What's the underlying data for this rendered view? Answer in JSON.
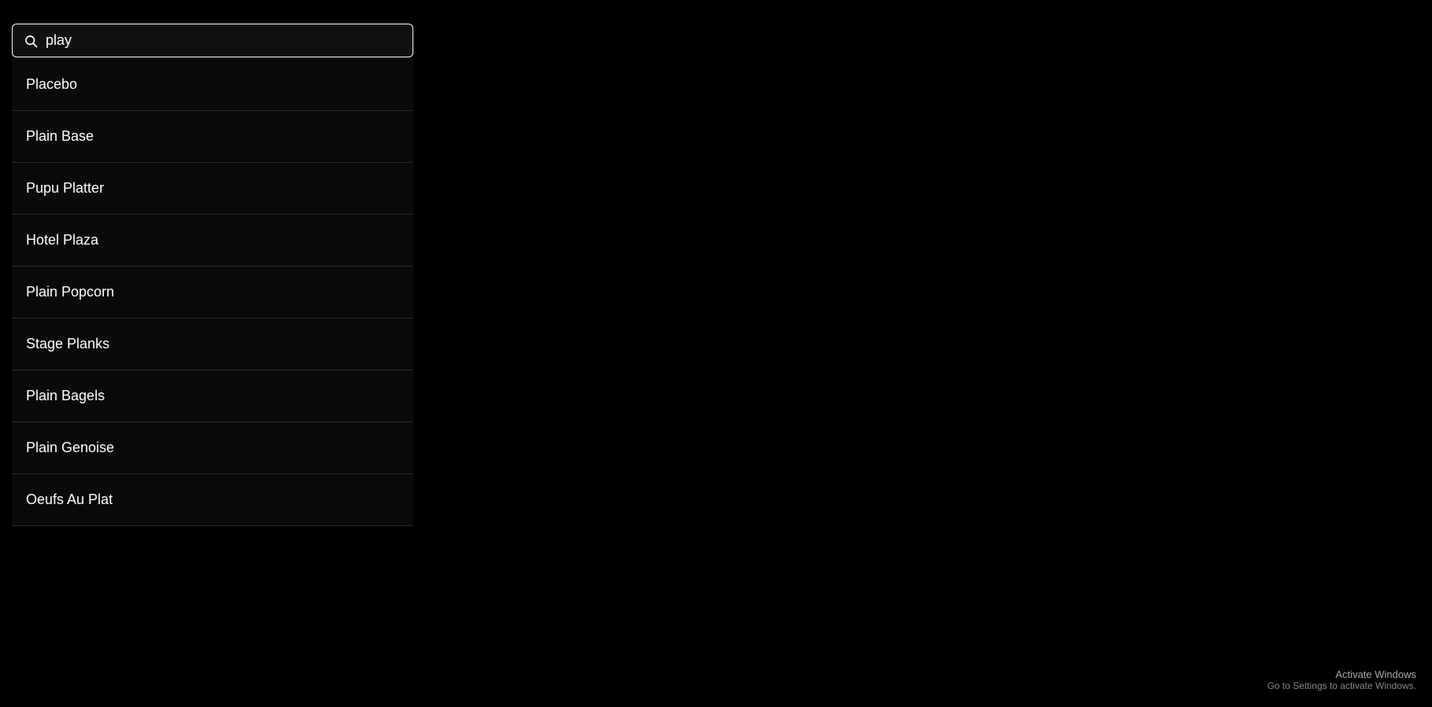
{
  "search": {
    "value": "play",
    "placeholder": "play"
  },
  "results": [
    {
      "id": 1,
      "label": "Placebo"
    },
    {
      "id": 2,
      "label": "Plain Base"
    },
    {
      "id": 3,
      "label": "Pupu Platter"
    },
    {
      "id": 4,
      "label": "Hotel Plaza"
    },
    {
      "id": 5,
      "label": "Plain Popcorn"
    },
    {
      "id": 6,
      "label": "Stage Planks"
    },
    {
      "id": 7,
      "label": "Plain Bagels"
    },
    {
      "id": 8,
      "label": "Plain Genoise"
    },
    {
      "id": 9,
      "label": "Oeufs Au Plat"
    }
  ],
  "activate": {
    "title": "Activate Windows",
    "subtitle": "Go to Settings to activate Windows."
  }
}
